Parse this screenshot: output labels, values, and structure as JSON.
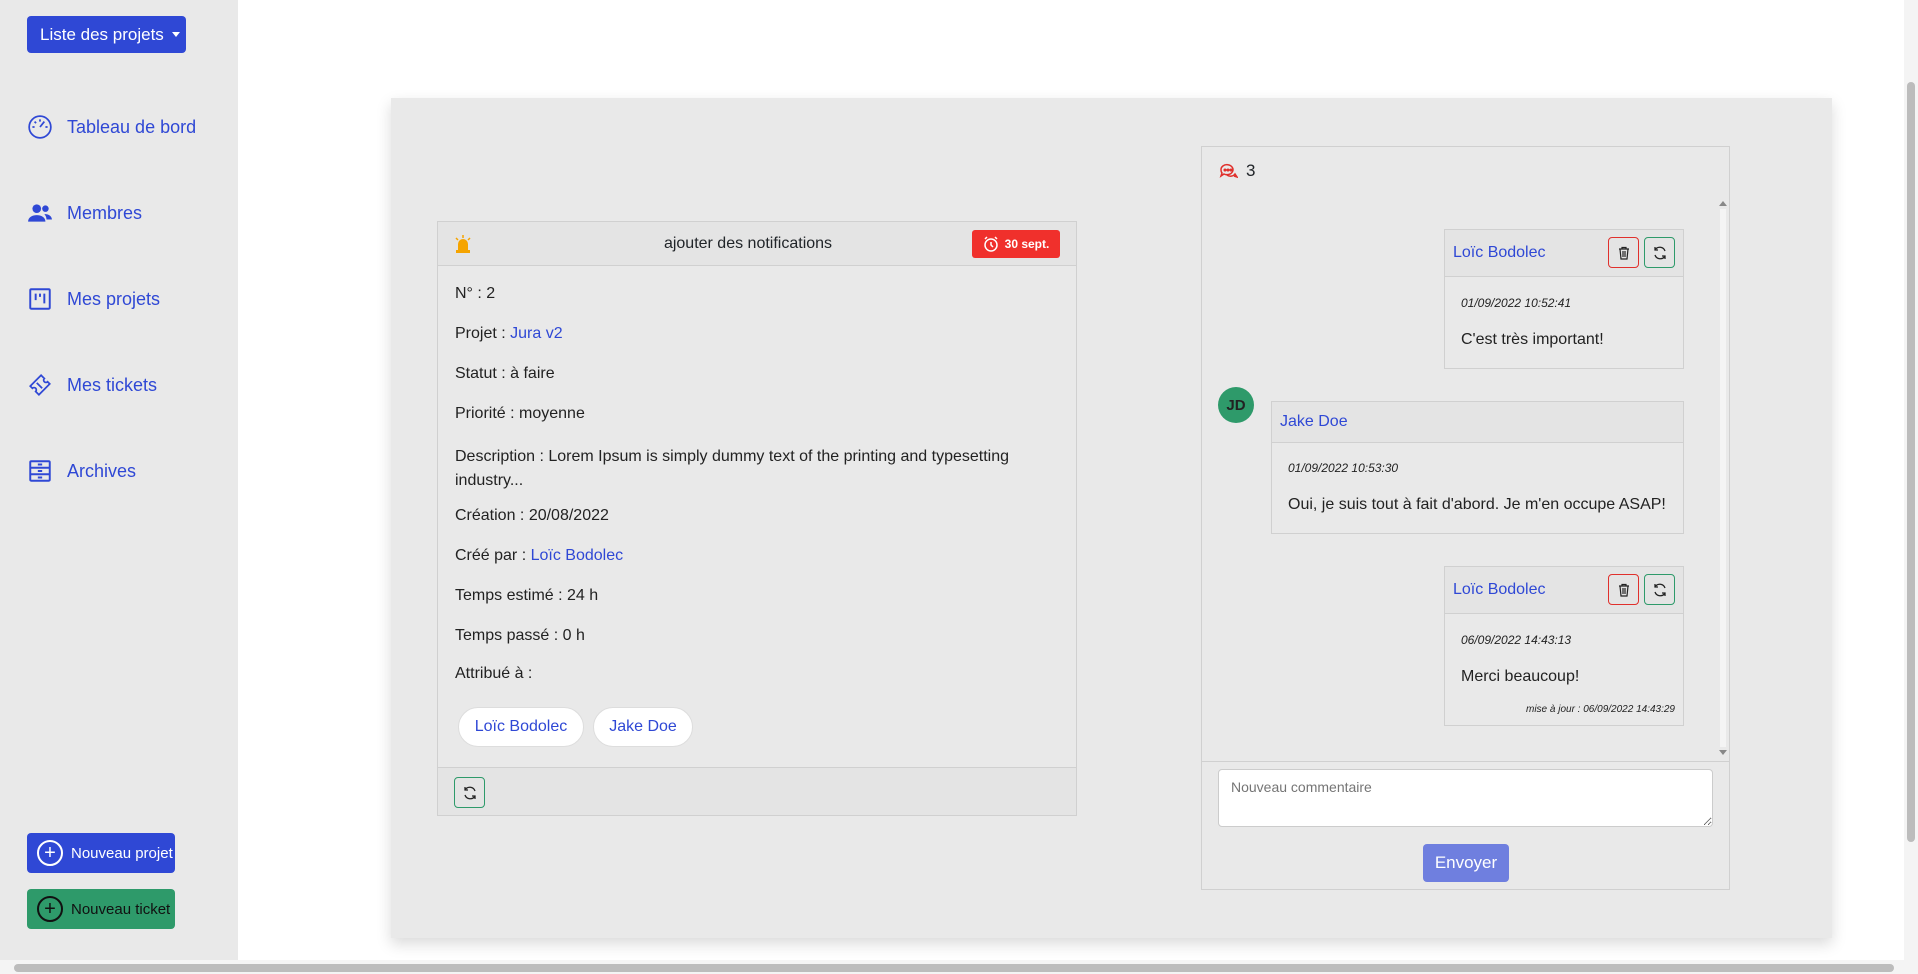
{
  "sidebar": {
    "project_dropdown": "Liste des projets",
    "nav": [
      {
        "label": "Tableau de bord",
        "icon": "speedometer-icon"
      },
      {
        "label": "Membres",
        "icon": "people-icon"
      },
      {
        "label": "Mes projets",
        "icon": "kanban-icon"
      },
      {
        "label": "Mes tickets",
        "icon": "ticket-icon"
      },
      {
        "label": "Archives",
        "icon": "archive-icon"
      }
    ],
    "new_project": "Nouveau projet",
    "new_ticket": "Nouveau ticket"
  },
  "ticket": {
    "title": "ajouter des notifications",
    "due_badge": "30 sept.",
    "number_label": "N° : ",
    "number": "2",
    "project_label": "Projet : ",
    "project": "Jura v2",
    "status": "Statut : à faire",
    "priority": "Priorité : moyenne",
    "description": "Description : Lorem Ipsum is simply dummy text of the printing and typesetting industry...",
    "created": "Création : 20/08/2022",
    "created_by_label": "Créé par : ",
    "created_by": "Loïc Bodolec",
    "estimated": "Temps estimé : 24 h",
    "spent": "Temps passé : 0 h",
    "assigned_label": "Attribué à :",
    "assignees": [
      "Loïc Bodolec",
      "Jake Doe"
    ]
  },
  "comments": {
    "count": "3",
    "items": [
      {
        "author": "Loïc Bodolec",
        "date": "01/09/2022 10:52:41",
        "text": "C'est très important!",
        "own": true
      },
      {
        "author": "Jake Doe",
        "initials": "JD",
        "date": "01/09/2022 10:53:30",
        "text": "Oui, je suis tout à fait d'abord. Je m'en occupe ASAP!",
        "own": false
      },
      {
        "author": "Loïc Bodolec",
        "date": "06/09/2022 14:43:13",
        "text": "Merci beaucoup!",
        "updated": "mise à jour : 06/09/2022 14:43:29",
        "own": true
      }
    ],
    "input_placeholder": "Nouveau commentaire",
    "send": "Envoyer"
  },
  "colors": {
    "primary": "#2f48d5",
    "success": "#2e9a6a",
    "danger": "#f0302c",
    "sidebar_bg": "#e9e9e9"
  }
}
